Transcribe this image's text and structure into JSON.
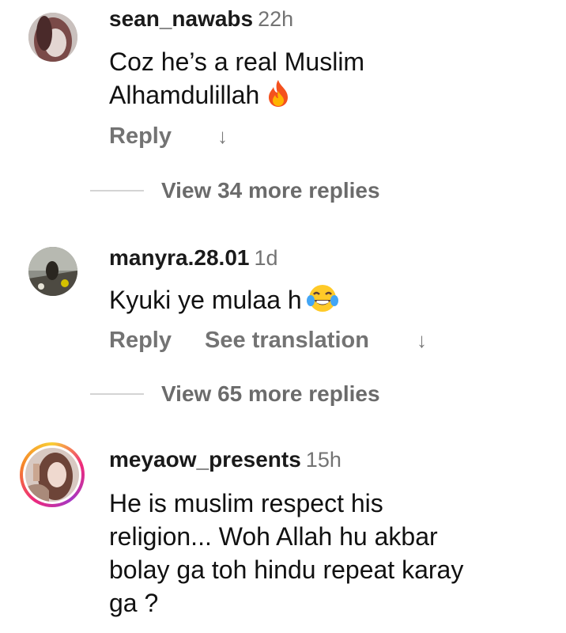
{
  "comments": [
    {
      "username": "sean_nawabs",
      "time": "22h",
      "text_line1": "Coz he’s a real Muslim",
      "text_line2": "Alhamdulillah",
      "emoji": "fire-icon",
      "reply_label": "Reply",
      "view_more": "View 34 more replies"
    },
    {
      "username": "manyra.28.01",
      "time": "1d",
      "text_line1": "Kyuki ye mulaa h",
      "emoji": "tears-of-joy-icon",
      "reply_label": "Reply",
      "translation_label": "See translation",
      "view_more": "View 65 more replies"
    },
    {
      "username": "meyaow_presents",
      "time": "15h",
      "text_lines": [
        "He is muslim respect his",
        "religion... Woh Allah hu akbar",
        "bolay ga toh hindu repeat karay",
        "ga ?"
      ],
      "story_ring": true
    }
  ],
  "colors": {
    "username": "#1a1a1a",
    "meta": "#737373",
    "story_ring": [
      "#f9ce34",
      "#ee2a7b",
      "#a637c3"
    ]
  }
}
